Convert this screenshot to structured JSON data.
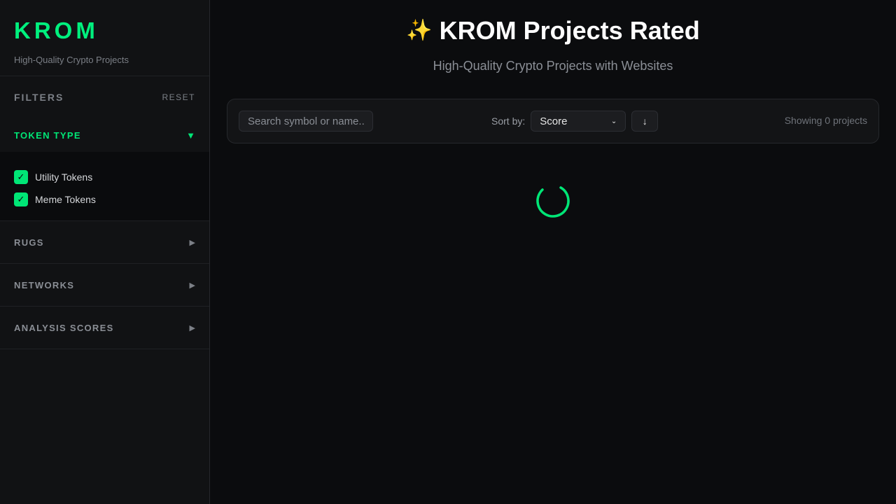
{
  "brand": {
    "logo": "KROM",
    "tagline": "High-Quality Crypto Projects"
  },
  "filters": {
    "title": "FILTERS",
    "reset_label": "RESET",
    "sections": [
      {
        "title": "TOKEN TYPE",
        "expanded": true,
        "arrow": "▼",
        "options": [
          {
            "label": "Utility Tokens",
            "checked": true,
            "check_mark": "✓"
          },
          {
            "label": "Meme Tokens",
            "checked": true,
            "check_mark": "✓"
          }
        ]
      },
      {
        "title": "RUGS",
        "expanded": false,
        "arrow": "▶"
      },
      {
        "title": "NETWORKS",
        "expanded": false,
        "arrow": "▶"
      },
      {
        "title": "ANALYSIS SCORES",
        "expanded": false,
        "arrow": "▶"
      }
    ]
  },
  "header": {
    "icon": "✨",
    "title": "KROM Projects Rated",
    "subtitle": "High-Quality Crypto Projects with Websites"
  },
  "toolbar": {
    "search_placeholder": "Search symbol or name...",
    "sort_label": "Sort by:",
    "sort_value": "Score",
    "sort_chevron": "⌄",
    "sort_direction_icon": "↓",
    "result_count": "Showing 0 projects"
  },
  "colors": {
    "accent": "#00e676",
    "background": "#0b0c0e",
    "sidebar": "#111214"
  },
  "icons": {
    "sparkle": "sparkles-icon",
    "spinner": "loading-spinner-icon"
  }
}
